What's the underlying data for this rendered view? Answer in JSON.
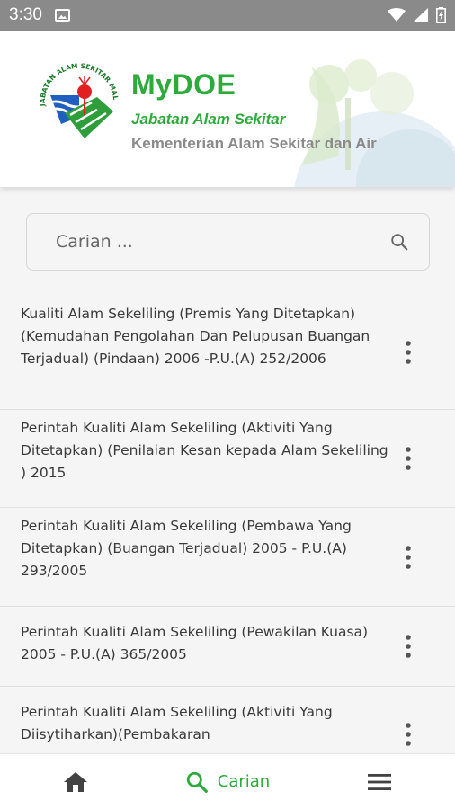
{
  "status_bar": {
    "time": "3:30",
    "icons": [
      "image-icon",
      "wifi-icon",
      "signal-icon",
      "battery-icon"
    ]
  },
  "header": {
    "app_title": "MyDOE",
    "subtitle_1": "Jabatan Alam Sekitar",
    "subtitle_2": "Kementerian Alam Sekitar dan Air",
    "logo_text": "JABATAN ALAM SEKITAR MALAYSIA"
  },
  "search": {
    "placeholder": "Carian ...",
    "value": ""
  },
  "list": {
    "items": [
      {
        "text": "Kualiti Alam Sekeliling (Premis Yang Ditetapkan) (Kemudahan Pengolahan Dan Pelupusan Buangan Terjadual) (Pindaan) 2006 -P.U.(A) 252/2006"
      },
      {
        "text": "Perintah Kualiti Alam Sekeliling (Aktiviti Yang Ditetapkan) (Penilaian Kesan kepada Alam Sekeliling ) 2015"
      },
      {
        "text": "Perintah Kualiti Alam Sekeliling (Pembawa Yang Ditetapkan) (Buangan Terjadual) 2005 - P.U.(A) 293/2005"
      },
      {
        "text": "Perintah Kualiti Alam Sekeliling (Pewakilan Kuasa) 2005 - P.U.(A) 365/2005"
      },
      {
        "text": "Perintah Kualiti Alam Sekeliling (Aktiviti Yang Diisytiharkan)(Pembakaran"
      }
    ]
  },
  "bottom_nav": {
    "home_icon": "home-icon",
    "search_label": "Carian",
    "menu_icon": "hamburger-menu-icon",
    "active": "Carian"
  },
  "colors": {
    "brand_green": "#2eaa3c",
    "status_bar": "#8a8a8a",
    "text_dark": "#3a3a3a"
  }
}
